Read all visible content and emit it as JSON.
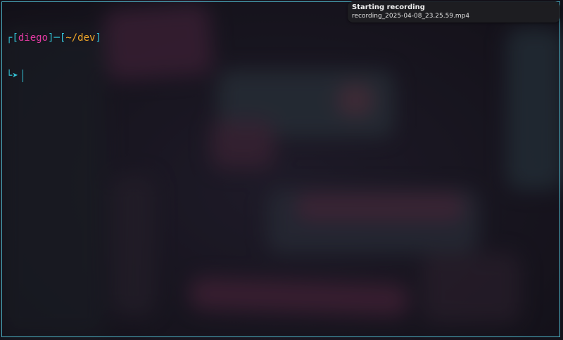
{
  "terminal": {
    "prompt": {
      "open_bracket": "[",
      "user": "diego",
      "close_bracket_dash": "]─[",
      "cwd": "~/dev",
      "close_bracket": "]",
      "line2_prefix": "└",
      "arrow": "➤"
    },
    "colors": {
      "bracket": "#33c3d6",
      "user": "#e23aa2",
      "cwd": "#f0a528",
      "border": "#4cb0c4"
    }
  },
  "notification": {
    "title": "Starting recording",
    "body": "recording_2025-04-08_23.25.59.mp4"
  }
}
